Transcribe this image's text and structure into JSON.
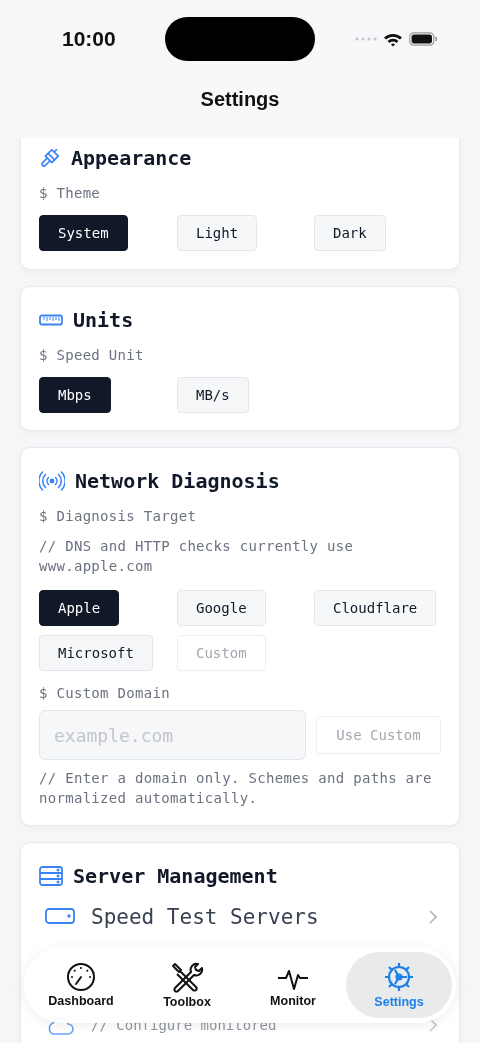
{
  "status_bar": {
    "time": "10:00"
  },
  "nav": {
    "title": "Settings"
  },
  "sections": [
    {
      "title": "Appearance",
      "label": "$ Theme",
      "options": [
        {
          "label": "System",
          "selected": true,
          "disabled": false
        },
        {
          "label": "Light",
          "selected": false,
          "disabled": false
        },
        {
          "label": "Dark",
          "selected": false,
          "disabled": false
        }
      ]
    },
    {
      "title": "Units",
      "label": "$ Speed Unit",
      "options": [
        {
          "label": "Mbps",
          "selected": true,
          "disabled": false
        },
        {
          "label": "MB/s",
          "selected": false,
          "disabled": false
        }
      ]
    },
    {
      "title": "Network Diagnosis",
      "label": "$ Diagnosis Target",
      "note": "// DNS and HTTP checks currently use www.apple.com",
      "options": [
        {
          "label": "Apple",
          "selected": true,
          "disabled": false
        },
        {
          "label": "Google",
          "selected": false,
          "disabled": false
        },
        {
          "label": "Cloudflare",
          "selected": false,
          "disabled": false
        },
        {
          "label": "Microsoft",
          "selected": false,
          "disabled": false
        },
        {
          "label": "Custom",
          "selected": false,
          "disabled": true
        }
      ],
      "custom": {
        "label": "$ Custom Domain",
        "placeholder": "example.com",
        "button": {
          "label": "Use Custom",
          "disabled": true
        },
        "hint": "// Enter a domain only. Schemes and paths are normalized automatically."
      }
    }
  ],
  "server_management": {
    "title": "Server Management",
    "rows": [
      {
        "title": "Speed Test Servers"
      },
      {
        "subtitle": "// Configure monitored"
      }
    ]
  },
  "tab_bar": [
    {
      "label": "Dashboard",
      "selected": false
    },
    {
      "label": "Toolbox",
      "selected": false
    },
    {
      "label": "Monitor",
      "selected": false
    },
    {
      "label": "Settings",
      "selected": true
    }
  ]
}
